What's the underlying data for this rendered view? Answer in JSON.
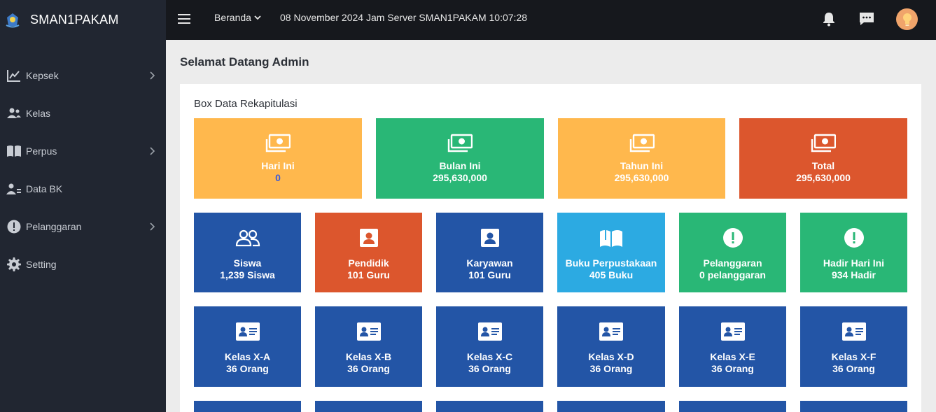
{
  "brand": {
    "name": "SMAN1PAKAM"
  },
  "sidebar": {
    "items": [
      {
        "label": "Kepsek",
        "icon": "chart-line-icon",
        "has_submenu": true
      },
      {
        "label": "Kelas",
        "icon": "users-icon",
        "has_submenu": false
      },
      {
        "label": "Perpus",
        "icon": "book-open-icon",
        "has_submenu": true
      },
      {
        "label": "Data BK",
        "icon": "user-cog-icon",
        "has_submenu": false
      },
      {
        "label": "Pelanggaran",
        "icon": "exclamation-circle-icon",
        "has_submenu": true
      },
      {
        "label": "Setting",
        "icon": "gear-icon",
        "has_submenu": false
      }
    ]
  },
  "topbar": {
    "home_label": "Beranda",
    "server_time": "08 November 2024 Jam Server SMAN1PAKAM 10:07:28"
  },
  "main": {
    "page_title": "Selamat Datang Admin",
    "card_title": "Box Data Rekapitulasi",
    "finance_tiles": [
      {
        "label": "Hari Ini",
        "value": "0",
        "color": "#ffb84d",
        "value_color": "#3b5bdb"
      },
      {
        "label": "Bulan Ini",
        "value": "295,630,000",
        "color": "#29b776"
      },
      {
        "label": "Tahun Ini",
        "value": "295,630,000",
        "color": "#ffb84d"
      },
      {
        "label": "Total",
        "value": "295,630,000",
        "color": "#dc562d"
      }
    ],
    "stat_tiles": [
      {
        "label": "Siswa",
        "value": "1,239 Siswa",
        "icon": "users-outline-icon",
        "color": "#2355a6"
      },
      {
        "label": "Pendidik",
        "value": "101 Guru",
        "icon": "user-badge-icon",
        "color": "#dc562d"
      },
      {
        "label": "Karyawan",
        "value": "101 Guru",
        "icon": "user-badge-icon",
        "color": "#2355a6"
      },
      {
        "label": "Buku Perpustakaan",
        "value": "405 Buku",
        "icon": "book-open-icon",
        "color": "#2caae2"
      },
      {
        "label": "Pelanggaran",
        "value": "0 pelanggaran",
        "icon": "exclamation-circle-icon",
        "color": "#29b776"
      },
      {
        "label": "Hadir Hari Ini",
        "value": "934 Hadir",
        "icon": "exclamation-circle-icon",
        "color": "#29b776"
      }
    ],
    "class_tiles": [
      {
        "label": "Kelas X-A",
        "value": "36 Orang"
      },
      {
        "label": "Kelas X-B",
        "value": "36 Orang"
      },
      {
        "label": "Kelas X-C",
        "value": "36 Orang"
      },
      {
        "label": "Kelas X-D",
        "value": "36 Orang"
      },
      {
        "label": "Kelas X-E",
        "value": "36 Orang"
      },
      {
        "label": "Kelas X-F",
        "value": "36 Orang"
      }
    ],
    "class_tile_color": "#2355a6"
  }
}
